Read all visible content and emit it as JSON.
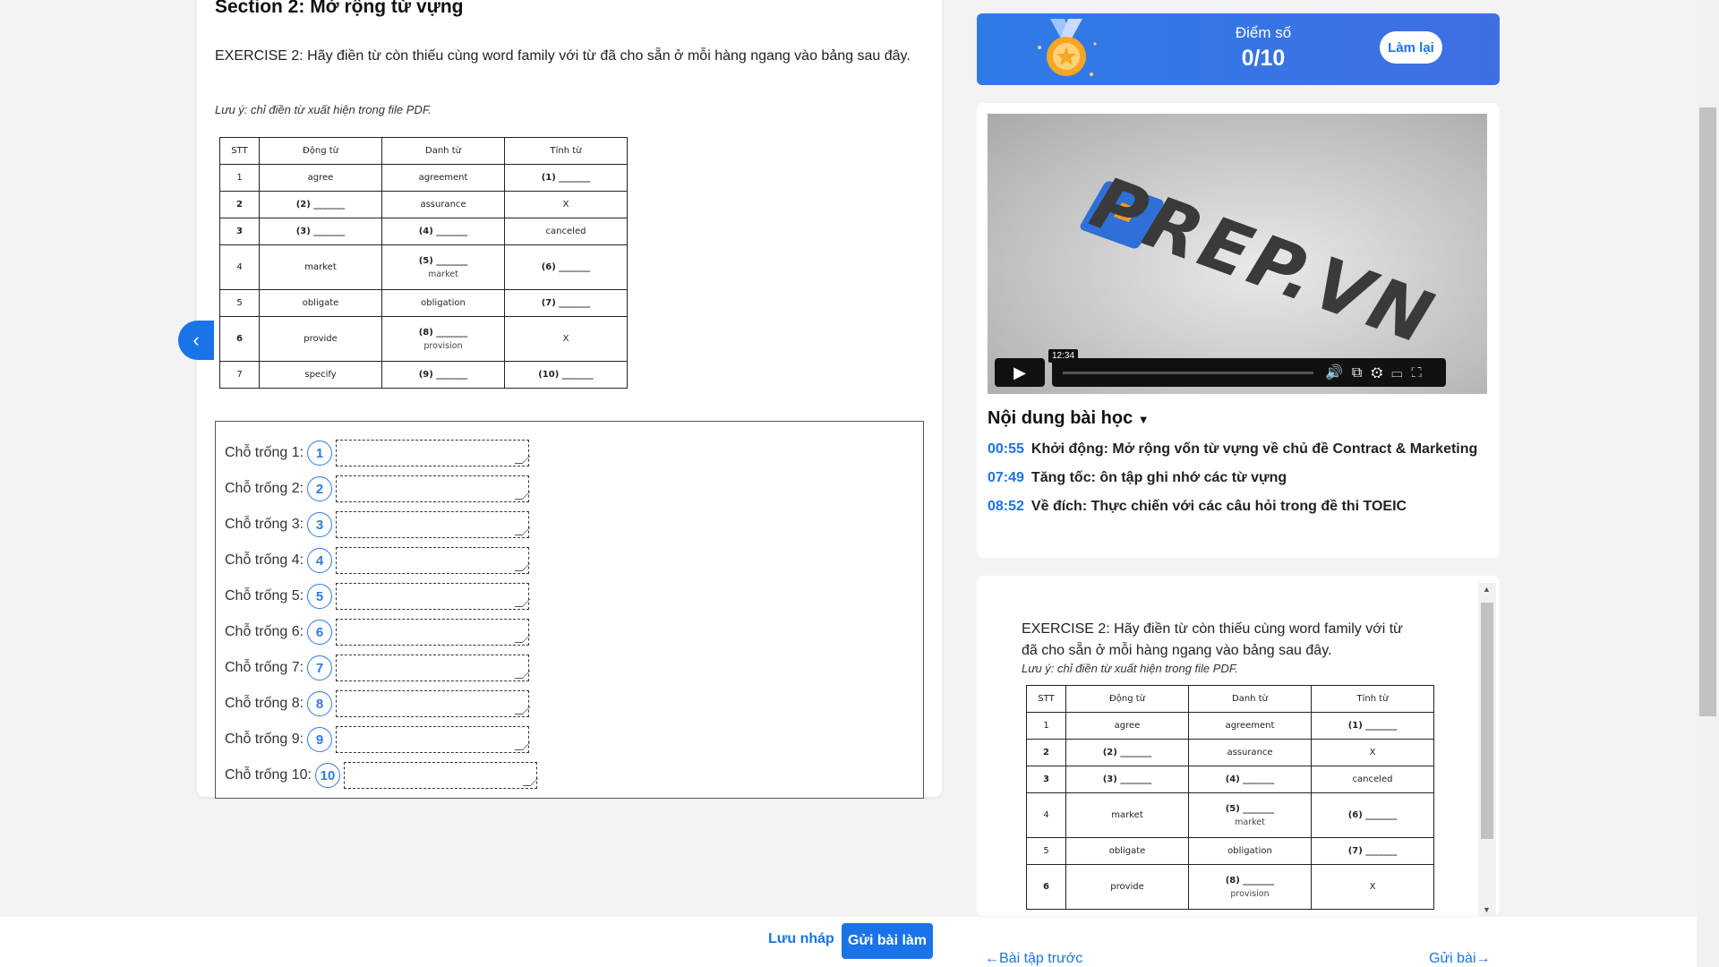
{
  "section_title": "Section 2: Mở rộng từ vựng",
  "exercise_text": "EXERCISE 2: Hãy điền từ còn thiếu cùng word family với từ đã cho sẵn ở mỗi hàng ngang vào bảng sau đây.",
  "note": "Lưu ý: chỉ điền từ xuất hiện trong file PDF.",
  "table": {
    "headers": [
      "STT",
      "Động từ",
      "Danh từ",
      "Tính từ"
    ],
    "rows": [
      {
        "stt": "1",
        "verb": "agree",
        "noun": "agreement",
        "adj": "(1) _______"
      },
      {
        "stt": "2",
        "verb": "(2) _______",
        "noun": "assurance",
        "adj": "X"
      },
      {
        "stt": "3",
        "verb": "(3) _______",
        "noun": "(4) _______",
        "adj": "canceled"
      },
      {
        "stt": "4",
        "verb": "market",
        "noun": "(5) _______",
        "noun_sub": "market",
        "adj": "(6) _______"
      },
      {
        "stt": "5",
        "verb": "obligate",
        "noun": "obligation",
        "adj": "(7) _______"
      },
      {
        "stt": "6",
        "verb": "provide",
        "noun": "(8) _______",
        "noun_sub": "provision",
        "adj": "X"
      },
      {
        "stt": "7",
        "verb": "specify",
        "noun": "(9) _______",
        "adj": "(10)      _______"
      }
    ]
  },
  "answers": [
    {
      "label": "Chỗ trống 1:",
      "num": "1"
    },
    {
      "label": "Chỗ trống 2:",
      "num": "2"
    },
    {
      "label": "Chỗ trống 3:",
      "num": "3"
    },
    {
      "label": "Chỗ trống 4:",
      "num": "4"
    },
    {
      "label": "Chỗ trống 5:",
      "num": "5"
    },
    {
      "label": "Chỗ trống 6:",
      "num": "6"
    },
    {
      "label": "Chỗ trống 7:",
      "num": "7"
    },
    {
      "label": "Chỗ trống 8:",
      "num": "8"
    },
    {
      "label": "Chỗ trống 9:",
      "num": "9"
    },
    {
      "label": "Chỗ trống 10:",
      "num": "10"
    }
  ],
  "score": {
    "label": "Điểm số",
    "value": "0/10",
    "retry": "Làm lại"
  },
  "video": {
    "logo_text": "PREP.VN",
    "tooltip_time": "12:34"
  },
  "toc": {
    "title": "Nội dung bài học",
    "items": [
      {
        "time": "00:55",
        "text": "Khởi động: Mở rộng vốn từ vựng về chủ đề Contract & Marketing"
      },
      {
        "time": "07:49",
        "text": "Tăng tốc: ôn tập ghi nhớ các từ vựng"
      },
      {
        "time": "08:52",
        "text": "Về đích: Thực chiến với các câu hỏi trong đề thi TOEIC"
      }
    ]
  },
  "doc_preview": {
    "exercise_text": "EXERCISE 2: Hãy điền từ còn thiếu cùng word family với từ đã cho sẵn ở mỗi hàng ngang vào bảng sau đây.",
    "note": "Lưu ý: chỉ điền từ xuất hiện trong file PDF."
  },
  "footer": {
    "save_draft": "Lưu nháp",
    "submit": "Gửi bài làm",
    "prev": "←Bài tập trước",
    "next": "Gửi bài→"
  }
}
